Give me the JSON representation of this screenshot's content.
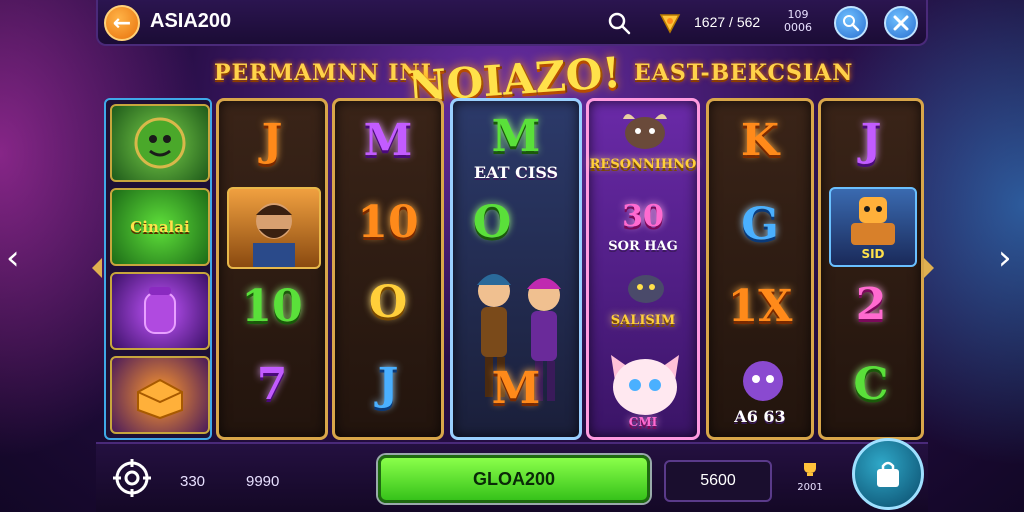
{
  "header": {
    "title": "ASIA200",
    "balance": "1627 / 562",
    "stat_top_line1": "109",
    "stat_top_line2": "0006"
  },
  "banner": {
    "left_heading": "PERMAMNN INL",
    "logo": "NOIAZO!",
    "right_heading": "EAST-BEKCSIAN"
  },
  "side_tiles": [
    {
      "label": "",
      "icon": "green-creature-icon"
    },
    {
      "label": "Cinalai",
      "icon": "green-chest-icon"
    },
    {
      "label": "",
      "icon": "purple-jar-icon"
    },
    {
      "label": "",
      "icon": "golden-box-icon"
    }
  ],
  "reels": [
    {
      "symbols": [
        "J",
        "",
        "10",
        "7"
      ]
    },
    {
      "symbols": [
        "M",
        "10",
        "O",
        "J"
      ]
    },
    {
      "symbols": [
        "M",
        "EAT CISS",
        "O",
        "M"
      ]
    },
    {
      "symbols": [
        "RESONNIHNO",
        "30",
        "SOR HAG",
        "SALISIM",
        "CMI"
      ]
    },
    {
      "symbols": [
        "K",
        "G",
        "1X",
        "A6 63"
      ]
    },
    {
      "symbols": [
        "J",
        "SID",
        "2",
        "C"
      ]
    }
  ],
  "bottom": {
    "bet_value_1": "330",
    "bet_value_2": "9990",
    "spin_label": "GLOA200",
    "win_value": "5600",
    "stat_bottom_line1": "",
    "stat_bottom_line2": "2001"
  },
  "colors": {
    "accent_gold": "#ffd24a",
    "spin_green": "#5ae03a",
    "background_purple": "#2a0f4a"
  }
}
